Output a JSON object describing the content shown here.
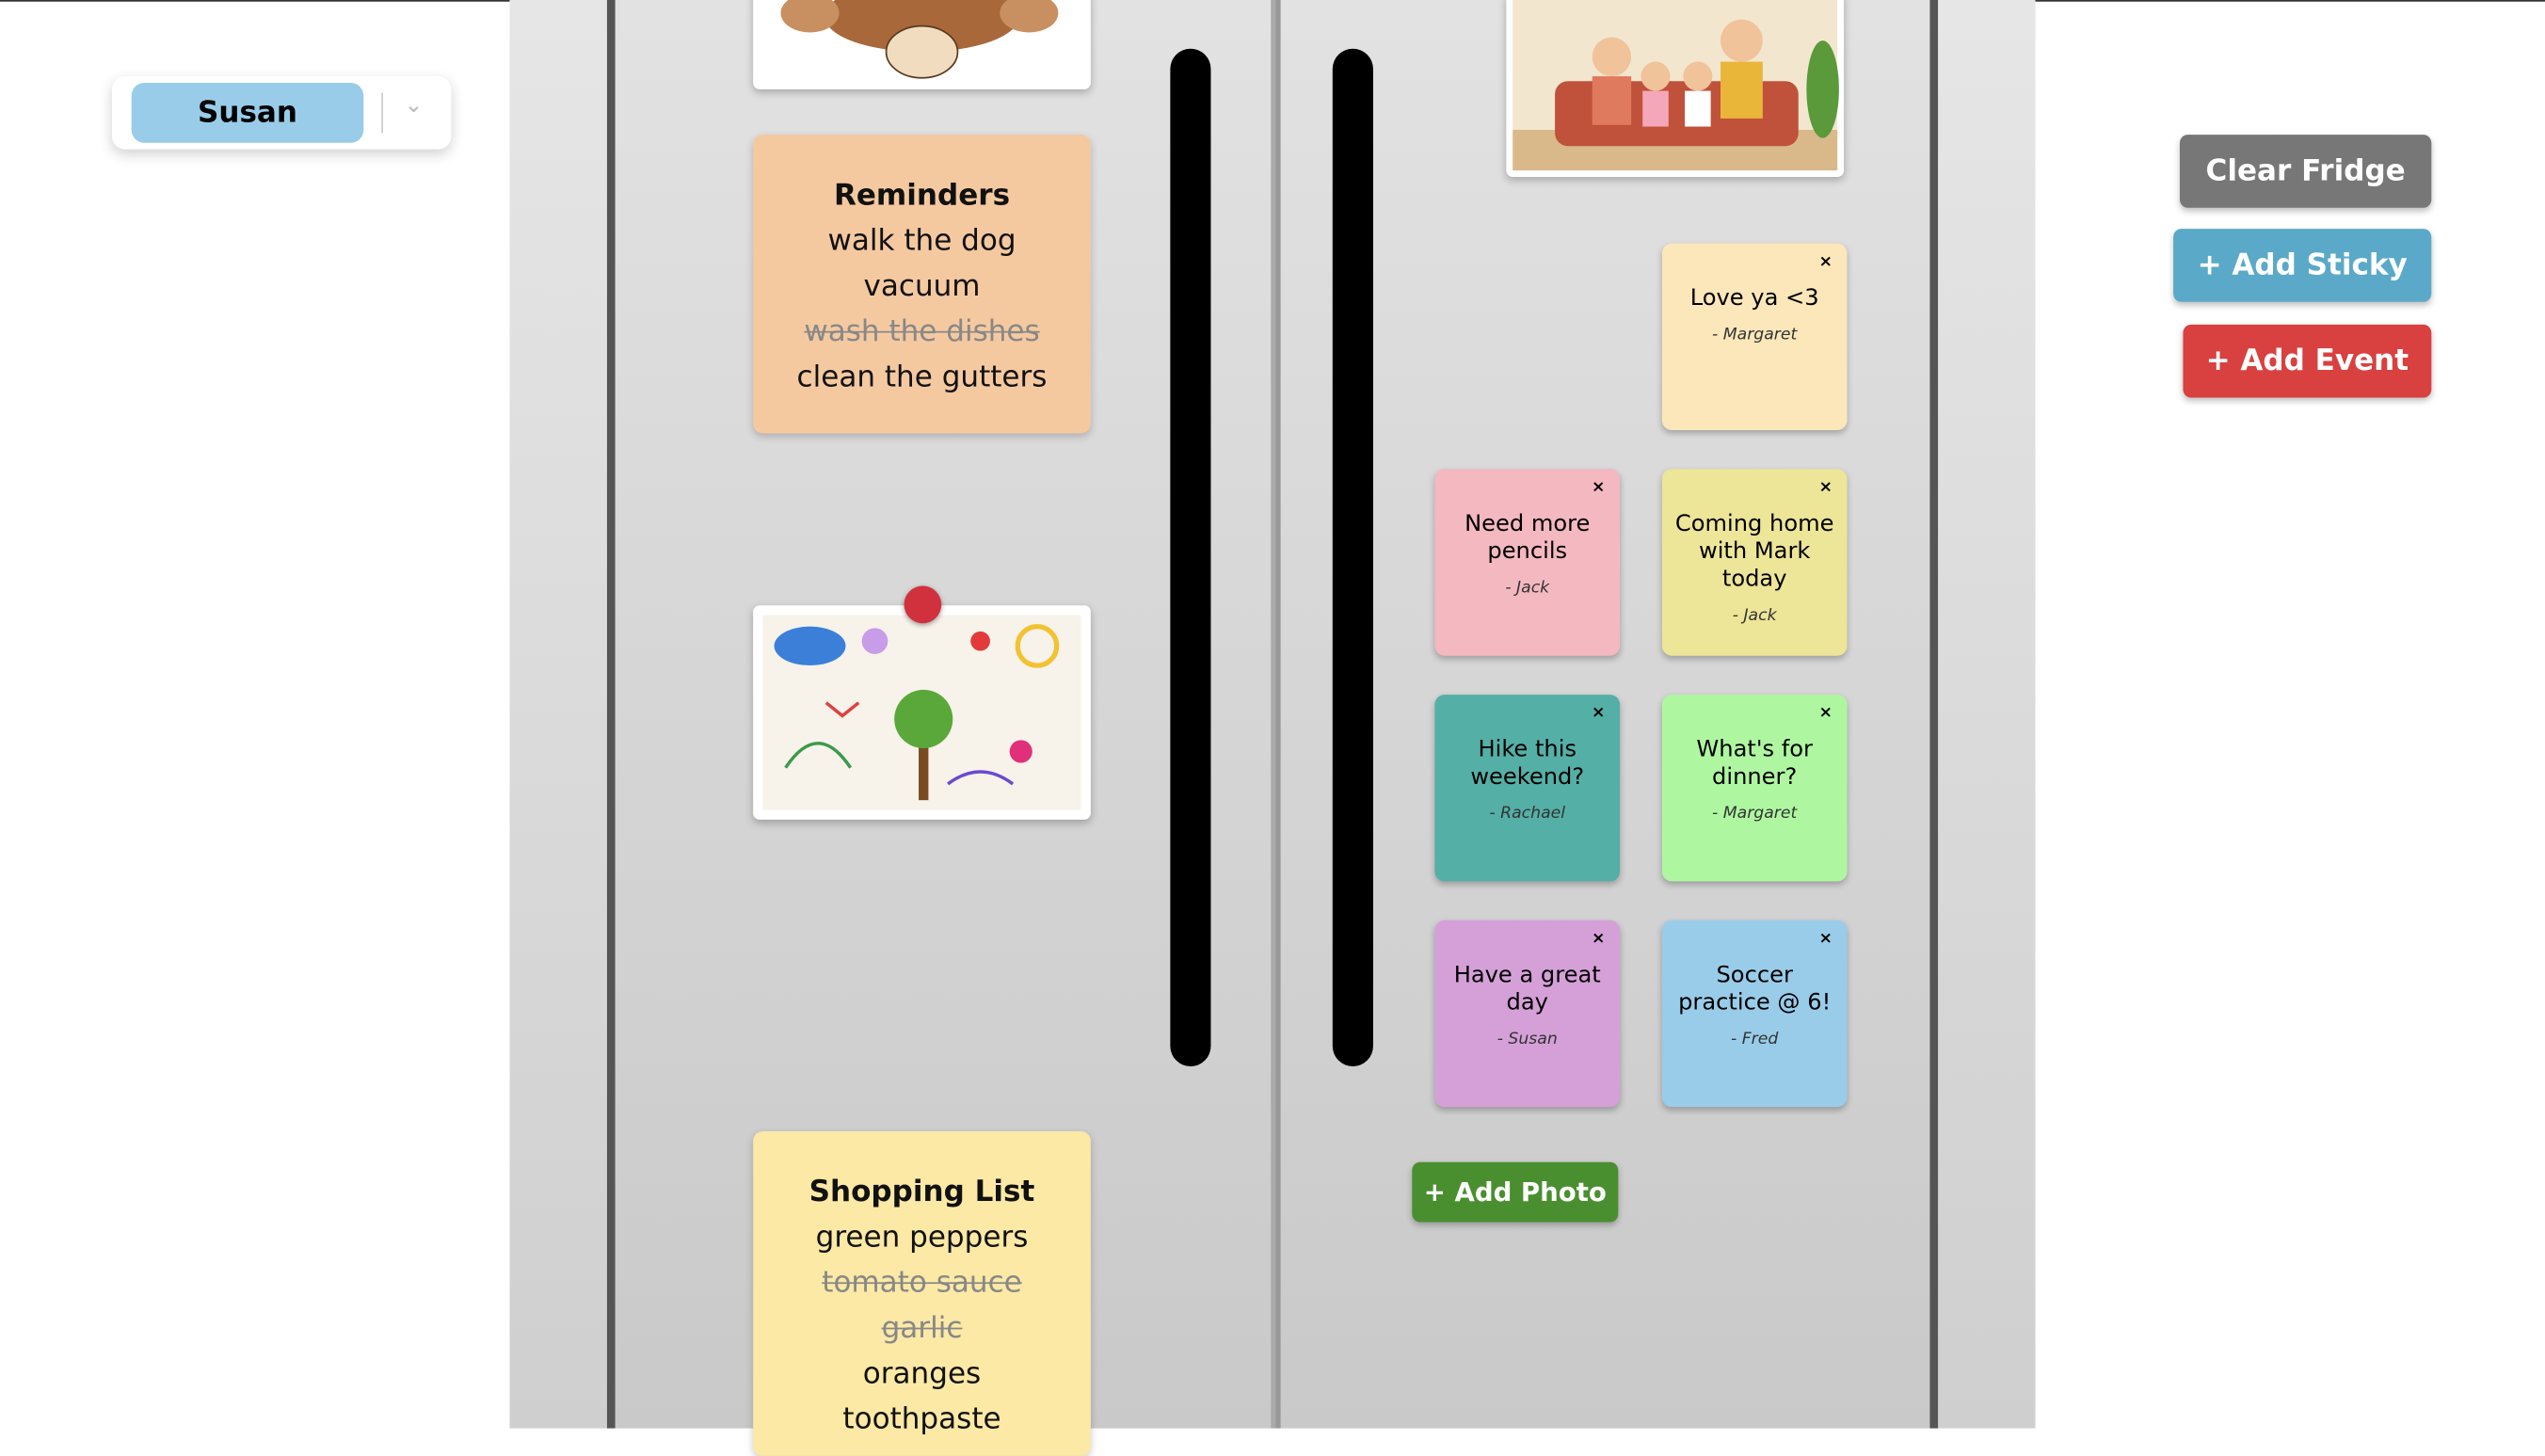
{
  "user_selector": {
    "selected": "Susan"
  },
  "buttons": {
    "clear_fridge": "Clear Fridge",
    "add_sticky": "+ Add Sticky",
    "add_event": "+ Add Event",
    "add_photo": "+ Add Photo"
  },
  "reminders": {
    "title": "Reminders",
    "items": [
      {
        "text": "walk the dog",
        "done": false
      },
      {
        "text": "vacuum",
        "done": false
      },
      {
        "text": "wash the dishes",
        "done": true
      },
      {
        "text": "clean the gutters",
        "done": false
      }
    ]
  },
  "shopping": {
    "title": "Shopping List",
    "items": [
      {
        "text": "green peppers",
        "done": false
      },
      {
        "text": "tomato sauce",
        "done": true
      },
      {
        "text": "garlic",
        "done": true
      },
      {
        "text": "oranges",
        "done": false
      },
      {
        "text": "toothpaste",
        "done": false
      }
    ]
  },
  "stickies": [
    {
      "msg": "Love ya <3",
      "by": "- Margaret",
      "color": "#fbe7b9"
    },
    {
      "msg": "Need more pencils",
      "by": "- Jack",
      "color": "#f4b8c0"
    },
    {
      "msg": "Coming home with Mark today",
      "by": "- Jack",
      "color": "#ede597"
    },
    {
      "msg": "Hike this weekend?",
      "by": "- Rachael",
      "color": "#54afa7"
    },
    {
      "msg": "What's for dinner?",
      "by": "- Margaret",
      "color": "#aef7a0"
    },
    {
      "msg": "Have a great day",
      "by": "- Susan",
      "color": "#d5a0d8"
    },
    {
      "msg": "Soccer practice @ 6!",
      "by": "- Fred",
      "color": "#99cce9"
    }
  ],
  "close_glyph": "×"
}
